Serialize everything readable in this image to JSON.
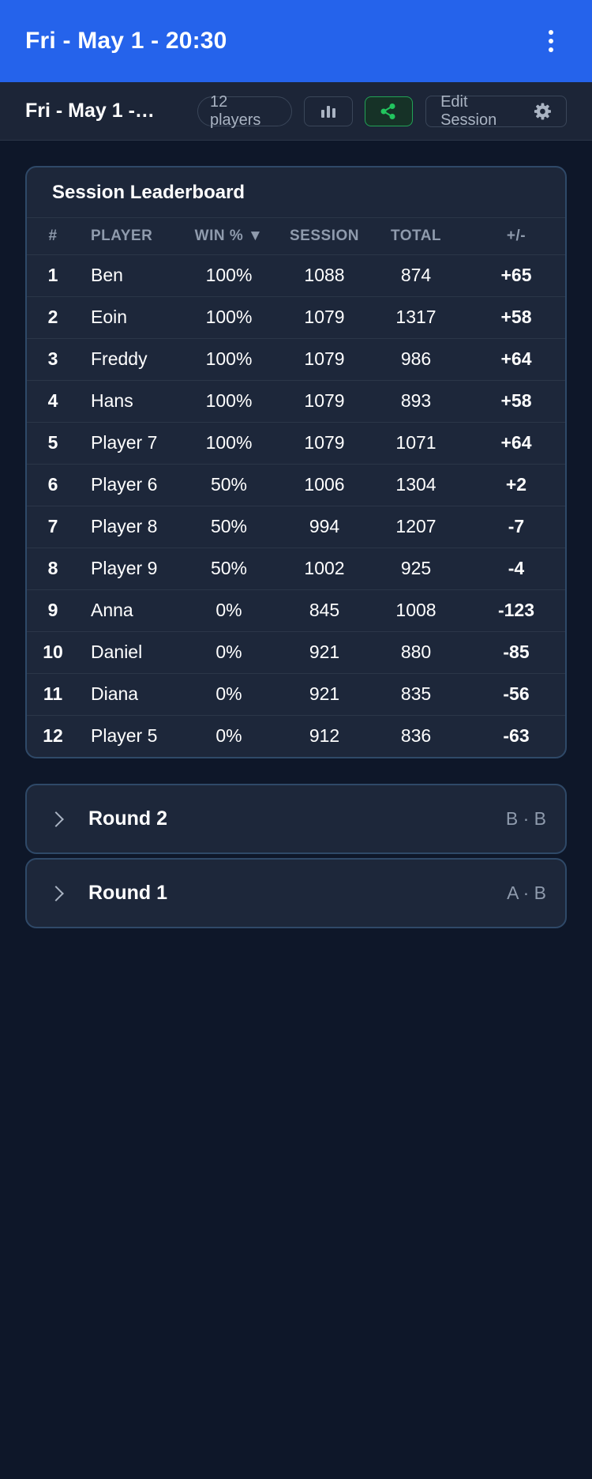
{
  "header": {
    "title": "Fri - May 1 - 20:30"
  },
  "subbar": {
    "session_name": "Fri - May 1 -…",
    "players_count": "12 players",
    "edit_label": "Edit Session"
  },
  "leaderboard": {
    "title": "Session Leaderboard",
    "columns": {
      "rank": "#",
      "player": "PLAYER",
      "win": "WIN % ▼",
      "session": "SESSION",
      "total": "TOTAL",
      "diff": "+/-"
    },
    "rows": [
      {
        "rank": "1",
        "player": "Ben",
        "win": "100%",
        "session": "1088",
        "total": "874",
        "diff": "+65"
      },
      {
        "rank": "2",
        "player": "Eoin",
        "win": "100%",
        "session": "1079",
        "total": "1317",
        "diff": "+58"
      },
      {
        "rank": "3",
        "player": "Freddy",
        "win": "100%",
        "session": "1079",
        "total": "986",
        "diff": "+64"
      },
      {
        "rank": "4",
        "player": "Hans",
        "win": "100%",
        "session": "1079",
        "total": "893",
        "diff": "+58"
      },
      {
        "rank": "5",
        "player": "Player 7",
        "win": "100%",
        "session": "1079",
        "total": "1071",
        "diff": "+64"
      },
      {
        "rank": "6",
        "player": "Player 6",
        "win": "50%",
        "session": "1006",
        "total": "1304",
        "diff": "+2"
      },
      {
        "rank": "7",
        "player": "Player 8",
        "win": "50%",
        "session": "994",
        "total": "1207",
        "diff": "-7"
      },
      {
        "rank": "8",
        "player": "Player 9",
        "win": "50%",
        "session": "1002",
        "total": "925",
        "diff": "-4"
      },
      {
        "rank": "9",
        "player": "Anna",
        "win": "0%",
        "session": "845",
        "total": "1008",
        "diff": "-123"
      },
      {
        "rank": "10",
        "player": "Daniel",
        "win": "0%",
        "session": "921",
        "total": "880",
        "diff": "-85"
      },
      {
        "rank": "11",
        "player": "Diana",
        "win": "0%",
        "session": "921",
        "total": "835",
        "diff": "-56"
      },
      {
        "rank": "12",
        "player": "Player 5",
        "win": "0%",
        "session": "912",
        "total": "836",
        "diff": "-63"
      }
    ]
  },
  "rounds": [
    {
      "label": "Round 2",
      "meta": "B · B"
    },
    {
      "label": "Round 1",
      "meta": "A · B"
    }
  ],
  "colors": {
    "appbar": "#2563eb",
    "background": "#0e1729",
    "card": "#1d273a",
    "share_accent": "#22a356"
  },
  "icons": {
    "menu": "more-vertical-icon",
    "stats": "bar-chart-icon",
    "share": "share-icon",
    "settings": "gear-icon",
    "expand": "chevron-right-icon"
  }
}
